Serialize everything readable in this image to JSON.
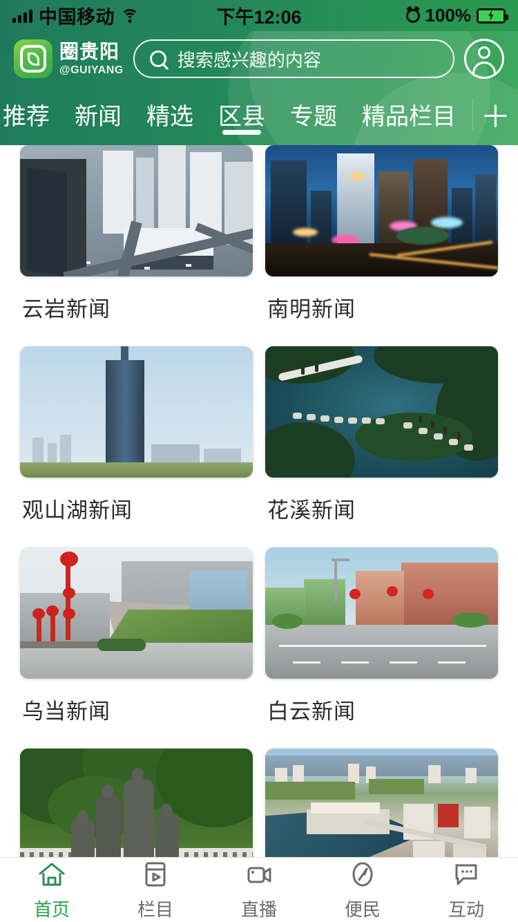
{
  "status_bar": {
    "carrier": "中国移动",
    "time": "下午12:06",
    "battery_percent": "100%",
    "icons": [
      "signal-bars-icon",
      "wifi-icon",
      "alarm-icon",
      "battery-charging-icon"
    ]
  },
  "header": {
    "logo_name": "圈贵阳",
    "logo_sub": "@GUIYANG",
    "search_placeholder": "搜索感兴趣的内容",
    "profile_icon": "user-avatar-icon",
    "brand_green": "#22845c",
    "brand_green_light": "#2aa04d"
  },
  "tabs": {
    "items": [
      {
        "label": "推荐",
        "active": false
      },
      {
        "label": "新闻",
        "active": false
      },
      {
        "label": "精选",
        "active": false
      },
      {
        "label": "区县",
        "active": true
      },
      {
        "label": "专题",
        "active": false
      },
      {
        "label": "精品栏目",
        "active": false
      }
    ],
    "add_label": "＋"
  },
  "grid": {
    "cards": [
      {
        "title": "云岩新闻",
        "scene": "aerial-day-city"
      },
      {
        "title": "南明新闻",
        "scene": "night-city"
      },
      {
        "title": "观山湖新闻",
        "scene": "skyscraper-haze"
      },
      {
        "title": "花溪新闻",
        "scene": "river-park-bridge"
      },
      {
        "title": "乌当新闻",
        "scene": "civic-building-lanterns"
      },
      {
        "title": "白云新闻",
        "scene": "street-lanterns"
      },
      {
        "title": "",
        "scene": "stone-statue-group"
      },
      {
        "title": "",
        "scene": "riverside-town-aerial"
      }
    ]
  },
  "bottom_nav": {
    "items": [
      {
        "label": "首页",
        "icon": "home-icon",
        "active": true
      },
      {
        "label": "栏目",
        "icon": "columns-video-icon",
        "active": false
      },
      {
        "label": "直播",
        "icon": "live-camera-icon",
        "active": false
      },
      {
        "label": "便民",
        "icon": "compass-icon",
        "active": false
      },
      {
        "label": "互动",
        "icon": "chat-bubble-icon",
        "active": false
      }
    ],
    "active_color": "#27a14a",
    "inactive_color": "#6b6b6b"
  }
}
